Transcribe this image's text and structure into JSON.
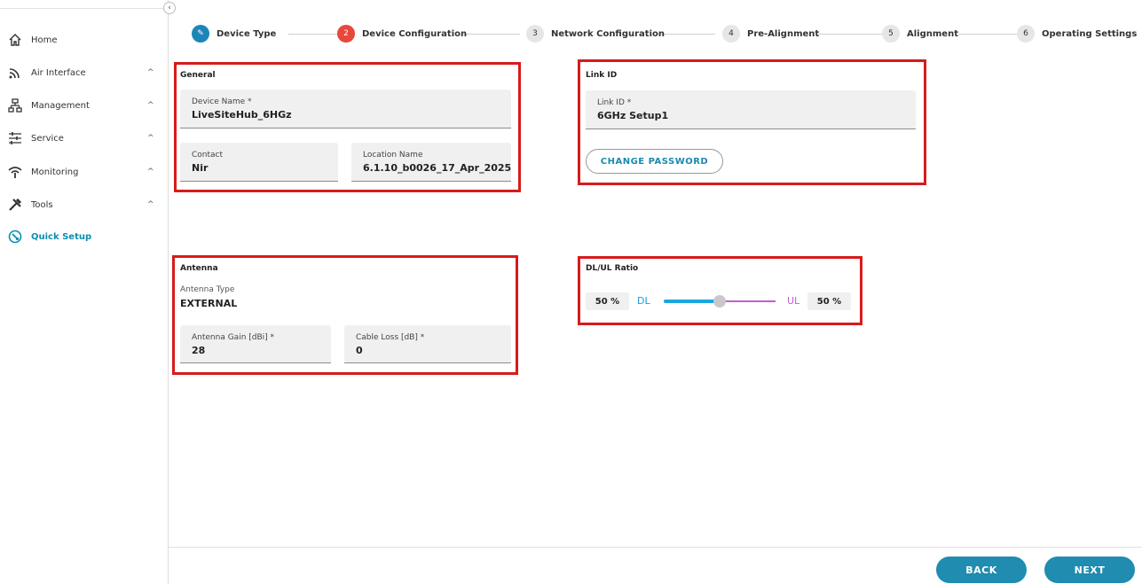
{
  "sidebar": {
    "items": [
      {
        "label": "Home",
        "icon": "home-icon",
        "chevron": ""
      },
      {
        "label": "Air Interface",
        "icon": "wireless-icon",
        "chevron": "^"
      },
      {
        "label": "Management",
        "icon": "network-tree-icon",
        "chevron": "^"
      },
      {
        "label": "Service",
        "icon": "sliders-icon",
        "chevron": "^"
      },
      {
        "label": "Monitoring",
        "icon": "signal-icon",
        "chevron": "^"
      },
      {
        "label": "Tools",
        "icon": "tools-icon",
        "chevron": "^"
      },
      {
        "label": "Quick Setup",
        "icon": "quick-setup-icon",
        "chevron": ""
      }
    ],
    "collapse_glyph": "‹"
  },
  "stepper": {
    "steps": [
      {
        "number": "✎",
        "label": "Device Type",
        "state": "done"
      },
      {
        "number": "2",
        "label": "Device Configuration",
        "state": "current"
      },
      {
        "number": "3",
        "label": "Network Configuration",
        "state": "pending"
      },
      {
        "number": "4",
        "label": "Pre-Alignment",
        "state": "pending"
      },
      {
        "number": "5",
        "label": "Alignment",
        "state": "pending"
      },
      {
        "number": "6",
        "label": "Operating Settings",
        "state": "pending"
      }
    ]
  },
  "general": {
    "title": "General",
    "device_name_label": "Device Name *",
    "device_name_value": "LiveSiteHub_6HGz",
    "contact_label": "Contact",
    "contact_value": "Nir",
    "location_label": "Location Name",
    "location_value": "6.1.10_b0026_17_Apr_2025"
  },
  "link_id": {
    "title": "Link ID",
    "field_label": "Link ID *",
    "field_value": "6GHz Setup1",
    "change_password": "CHANGE PASSWORD"
  },
  "antenna": {
    "title": "Antenna",
    "type_label": "Antenna Type",
    "type_value": "EXTERNAL",
    "gain_label": "Antenna Gain [dBi] *",
    "gain_value": "28",
    "cable_loss_label": "Cable Loss [dB] *",
    "cable_loss_value": "0"
  },
  "ratio": {
    "title": "DL/UL Ratio",
    "dl_percent": "50 %",
    "dl_label": "DL",
    "ul_label": "UL",
    "ul_percent": "50 %",
    "dl_fraction": 0.5
  },
  "footer": {
    "back": "BACK",
    "next": "NEXT"
  },
  "colors": {
    "accent": "#1f8cb0",
    "current_step": "#e8473a",
    "highlight_box": "#d81b1b",
    "dl": "#1aa7e0",
    "ul": "#c35ed0"
  }
}
